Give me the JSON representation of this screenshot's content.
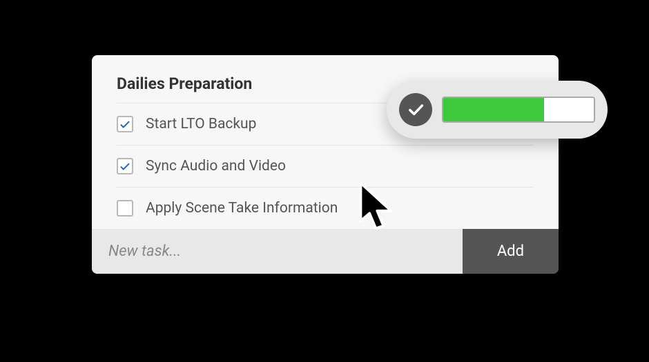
{
  "card": {
    "title": "Dailies Preparation",
    "tasks": [
      {
        "label": "Start LTO Backup",
        "checked": true
      },
      {
        "label": "Sync Audio and Video",
        "checked": true
      },
      {
        "label": "Apply Scene Take Information",
        "checked": false
      }
    ],
    "input_placeholder": "New task...",
    "add_label": "Add"
  },
  "progress": {
    "percent": 67
  },
  "colors": {
    "progress_fill": "#3cc93c",
    "check_accent": "#1a5fd0"
  }
}
